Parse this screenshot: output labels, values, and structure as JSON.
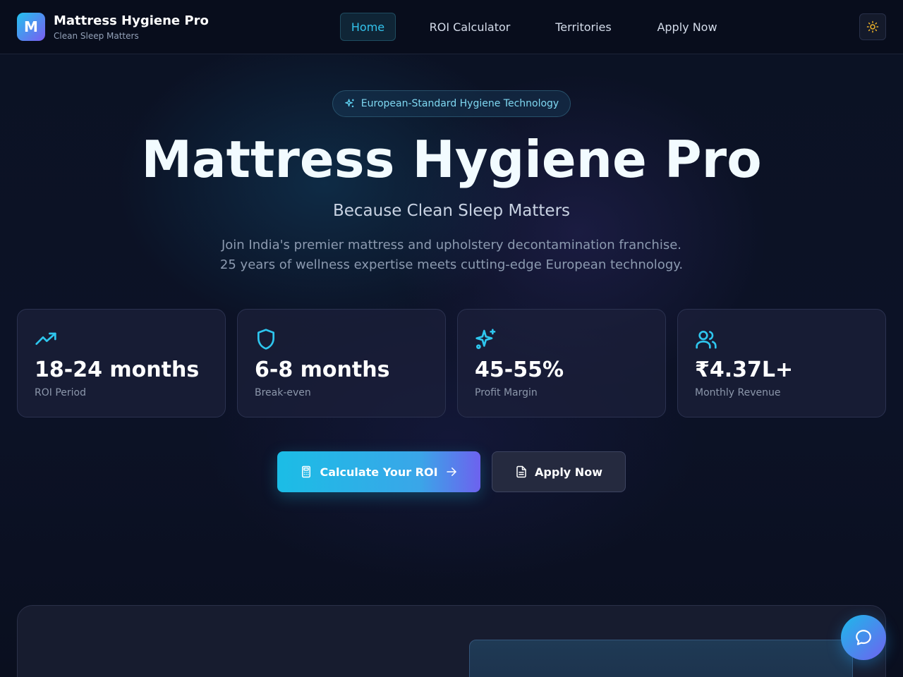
{
  "app": {
    "logo_letter": "M",
    "title": "Mattress Hygiene Pro",
    "subtitle": "Clean Sleep Matters"
  },
  "nav": {
    "items": [
      {
        "label": "Home",
        "active": true
      },
      {
        "label": "ROI Calculator",
        "active": false
      },
      {
        "label": "Territories",
        "active": false
      },
      {
        "label": "Apply Now",
        "active": false
      }
    ],
    "theme_toggle_icon": "sun-icon"
  },
  "hero": {
    "badge": "European-Standard Hygiene Technology",
    "badge_icon": "sparkles-icon",
    "title": "Mattress Hygiene Pro",
    "subtitle": "Because Clean Sleep Matters",
    "description_line1": "Join India's premier mattress and upholstery decontamination franchise.",
    "description_line2": "25 years of wellness expertise meets cutting-edge European technology."
  },
  "stats": [
    {
      "icon": "trending-up-icon",
      "value": "18-24 months",
      "label": "ROI Period"
    },
    {
      "icon": "shield-icon",
      "value": "6-8 months",
      "label": "Break-even"
    },
    {
      "icon": "sparkles-icon",
      "value": "45-55%",
      "label": "Profit Margin"
    },
    {
      "icon": "users-icon",
      "value": "₹4.37L+",
      "label": "Monthly Revenue"
    }
  ],
  "cta": {
    "primary_label": "Calculate Your ROI",
    "primary_icon": "calculator-icon",
    "primary_trailing_icon": "arrow-right-icon",
    "secondary_label": "Apply Now",
    "secondary_icon": "file-text-icon"
  },
  "chat": {
    "icon": "chat-bubble-icon"
  },
  "colors": {
    "accent": "#22c1ee",
    "accent_secondary": "#7b5cf0",
    "background": "#0a0f1f",
    "card": "#1c203a",
    "icon_accent": "#2ec6ee",
    "sun": "#f0b429"
  }
}
